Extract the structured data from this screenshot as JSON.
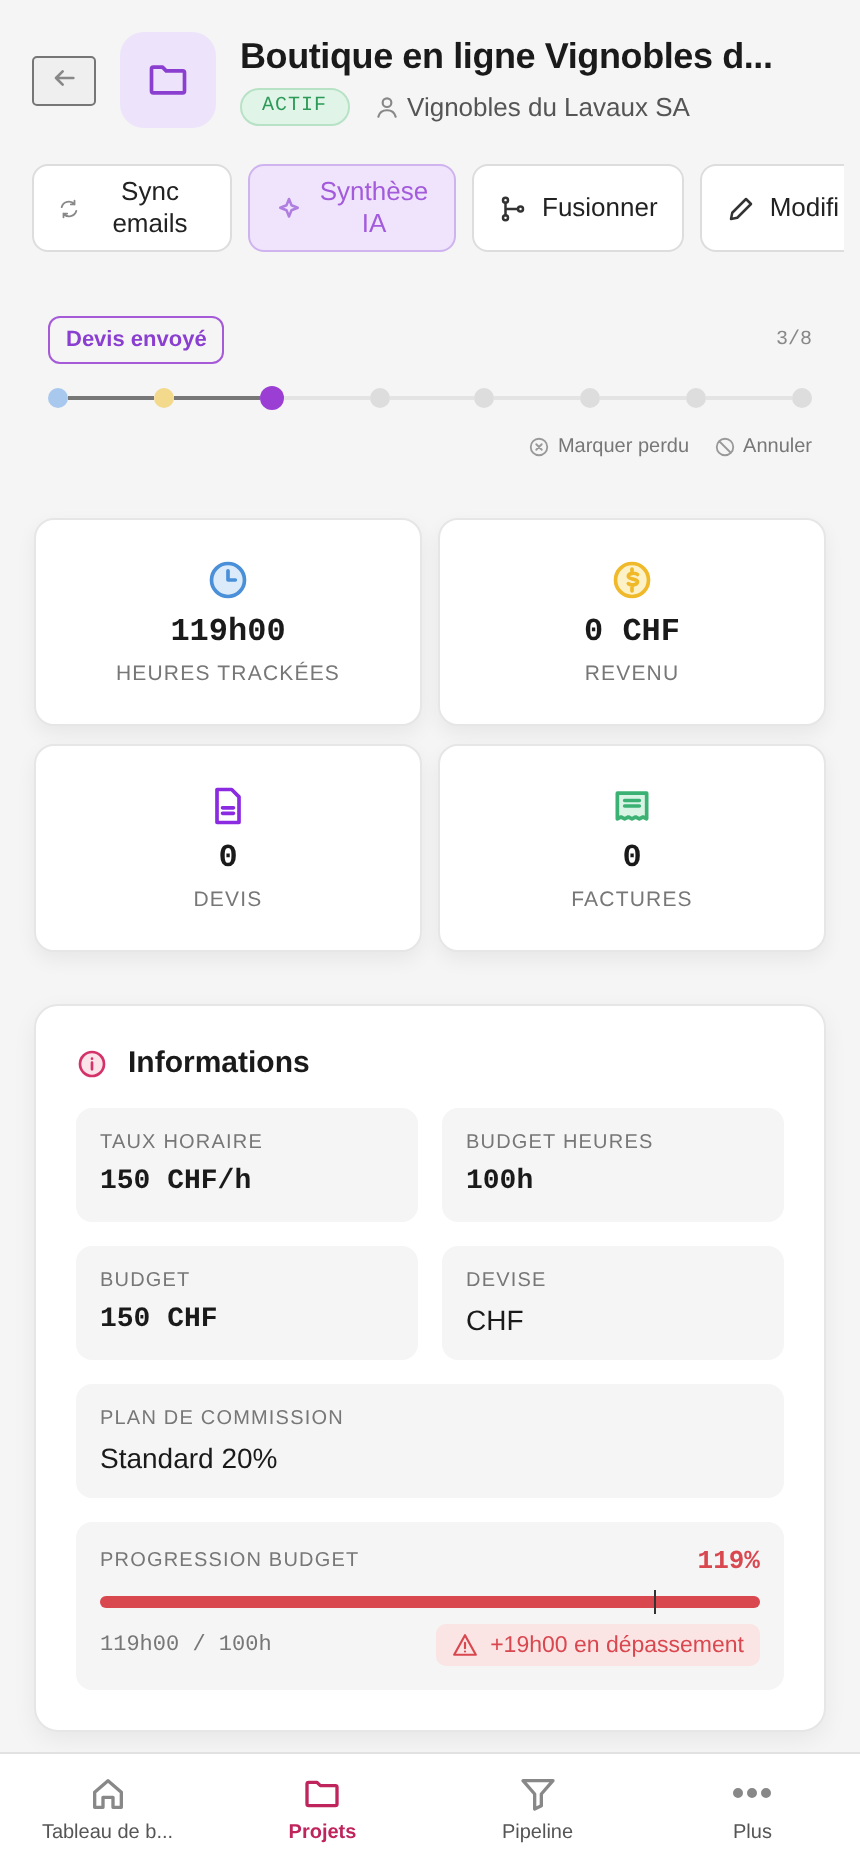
{
  "header": {
    "title": "Boutique en ligne Vignobles d...",
    "status": "ACTIF",
    "client": "Vignobles du Lavaux SA"
  },
  "actions": [
    {
      "label": "Sync emails",
      "selected": false
    },
    {
      "label": "Synthèse IA",
      "selected": true
    },
    {
      "label": "Fusionner",
      "selected": false
    },
    {
      "label": "Modifi",
      "selected": false
    }
  ],
  "pipeline": {
    "stage": "Devis envoyé",
    "counter": "3/8",
    "steps": [
      {
        "reached": true,
        "selected": false,
        "color": "#a8c8ee"
      },
      {
        "reached": true,
        "selected": false,
        "color": "#f3d98c"
      },
      {
        "reached": true,
        "selected": true,
        "color": "#9b3fd4"
      },
      {
        "reached": false,
        "selected": false,
        "color": "#dddddd"
      },
      {
        "reached": false,
        "selected": false,
        "color": "#dddddd"
      },
      {
        "reached": false,
        "selected": false,
        "color": "#dddddd"
      },
      {
        "reached": false,
        "selected": false,
        "color": "#dddddd"
      },
      {
        "reached": false,
        "selected": false,
        "color": "#dddddd"
      }
    ],
    "links": [
      "Marquer perdu",
      "Annuler"
    ]
  },
  "stats": [
    {
      "value": "119h00",
      "label": "HEURES TRACKÉES"
    },
    {
      "value": "0 CHF",
      "label": "REVENU"
    },
    {
      "value": "0",
      "label": "DEVIS"
    },
    {
      "value": "0",
      "label": "FACTURES"
    }
  ],
  "info": {
    "title": "Informations",
    "fields": [
      {
        "label": "TAUX HORAIRE",
        "value": "150 CHF/h",
        "kind": "mono",
        "wide": false
      },
      {
        "label": "BUDGET HEURES",
        "value": "100h",
        "kind": "mono",
        "wide": false
      },
      {
        "label": "BUDGET",
        "value": "150 CHF",
        "kind": "mono",
        "wide": false
      },
      {
        "label": "DEVISE",
        "value": "CHF",
        "kind": "text",
        "wide": false
      },
      {
        "label": "PLAN DE COMMISSION",
        "value": "Standard 20%",
        "kind": "text",
        "wide": true
      }
    ],
    "progress": {
      "label": "PROGRESSION BUDGET",
      "percent": "119%",
      "level": 1,
      "reading": "119h00 / 100h",
      "alert": "+19h00 en dépassement"
    }
  },
  "nav": [
    {
      "label": "Tableau de b...",
      "selected": false
    },
    {
      "label": "Projets",
      "selected": true
    },
    {
      "label": "Pipeline",
      "selected": false
    },
    {
      "label": "Plus",
      "selected": false
    }
  ]
}
